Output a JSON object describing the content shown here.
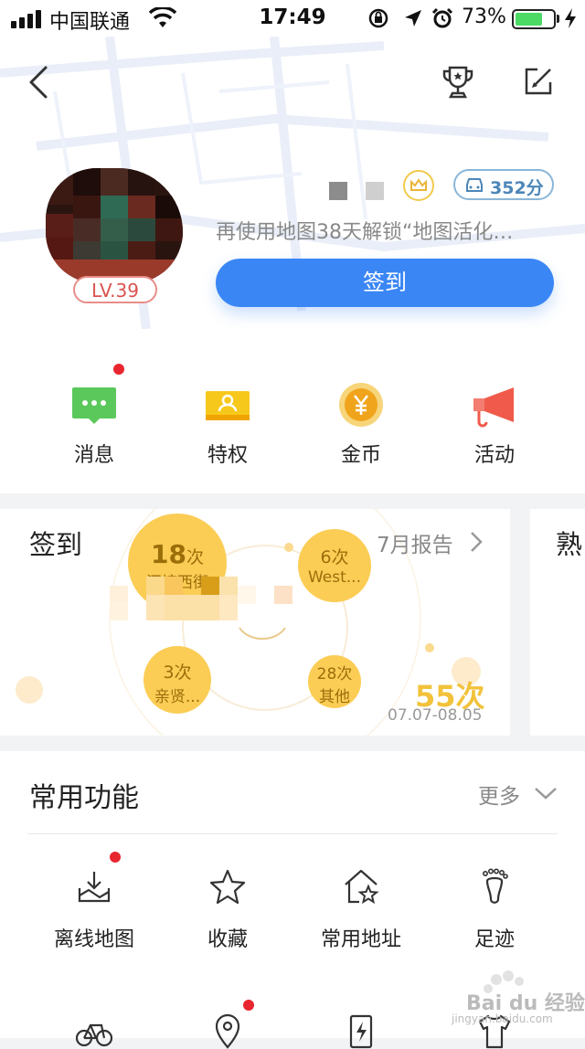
{
  "status_bar": {
    "carrier": "中国联通",
    "time": "17:49",
    "battery_percent": "73%",
    "battery_level": 0.73,
    "icons": [
      "signal-icon",
      "wifi-icon",
      "rotation-lock-icon",
      "location-icon",
      "alarm-icon",
      "battery-icon",
      "charging-icon"
    ]
  },
  "header": {
    "icons": [
      "back-icon",
      "trophy-icon",
      "edit-icon"
    ]
  },
  "profile": {
    "level": "LV.39",
    "points": "352分",
    "unlock_text": "再使用地图38天解锁“地图活化…",
    "checkin_button": "签到"
  },
  "quick_entries": [
    {
      "label": "消息",
      "icon": "message-icon",
      "has_dot": true
    },
    {
      "label": "特权",
      "icon": "privilege-icon",
      "has_dot": false
    },
    {
      "label": "金币",
      "icon": "gold-coin-icon",
      "has_dot": false
    },
    {
      "label": "活动",
      "icon": "megaphone-icon",
      "has_dot": false
    }
  ],
  "checkin_card": {
    "title": "签到",
    "report_link": "7月报告",
    "bubbles": [
      {
        "count": "18",
        "unit": "次",
        "name": "泗塘西街"
      },
      {
        "count": "6",
        "unit": "次",
        "name": "West..."
      },
      {
        "count": "3",
        "unit": "次",
        "name": "亲贤..."
      },
      {
        "count": "28",
        "unit": "次",
        "name": "其他"
      }
    ],
    "total": "55次",
    "date_range": "07.07-08.05"
  },
  "next_card": {
    "title": "熟"
  },
  "common_functions": {
    "title": "常用功能",
    "more": "更多",
    "items": [
      {
        "label": "离线地图",
        "icon": "offline-map-icon",
        "has_dot": true
      },
      {
        "label": "收藏",
        "icon": "star-icon",
        "has_dot": false
      },
      {
        "label": "常用地址",
        "icon": "home-star-icon",
        "has_dot": false
      },
      {
        "label": "足迹",
        "icon": "footprint-icon",
        "has_dot": false
      }
    ],
    "row2_icons": [
      "bicycle-icon",
      "location-pin-icon",
      "charging-station-icon",
      "tshirt-icon"
    ]
  },
  "watermark": {
    "text": "Bai du 经验",
    "url": "jingyan.baidu.com"
  },
  "colors": {
    "primary_blue": "#3a86f4",
    "bubble_yellow": "#fbcd55",
    "red_dot": "#e8262f",
    "level_red": "#d9534f"
  }
}
